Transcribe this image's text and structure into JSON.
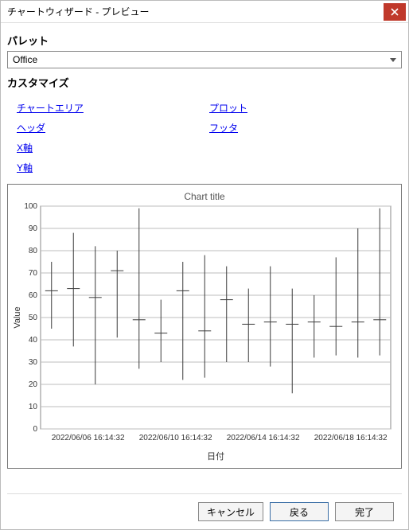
{
  "window": {
    "title": "チャートウィザード - プレビュー"
  },
  "palette": {
    "section_label": "パレット",
    "value": "Office"
  },
  "customize": {
    "section_label": "カスタマイズ",
    "links_left": [
      "チャートエリア",
      "ヘッダ",
      "X軸",
      "Y軸"
    ],
    "links_right": [
      "プロット",
      "フッタ"
    ]
  },
  "buttons": {
    "cancel": "キャンセル",
    "back": "戻る",
    "finish": "完了"
  },
  "chart_data": {
    "type": "bar",
    "title": "Chart title",
    "xlabel": "日付",
    "ylabel": "Value",
    "ylim": [
      0,
      100
    ],
    "yticks": [
      0,
      10,
      20,
      30,
      40,
      50,
      60,
      70,
      80,
      90,
      100
    ],
    "categories": [
      "2022/06/06 16:14:32",
      "",
      "",
      "",
      "2022/06/10 16:14:32",
      "",
      "",
      "",
      "2022/06/14 16:14:32",
      "",
      "",
      "",
      "2022/06/18 16:14:32",
      "",
      "",
      ""
    ],
    "visible_x_labels": [
      "2022/06/06 16:14:32",
      "2022/06/10 16:14:32",
      "2022/06/14 16:14:32",
      "2022/06/18 16:14:32"
    ],
    "series": [
      {
        "high": 75,
        "low": 45,
        "open": 62,
        "close": 62
      },
      {
        "high": 88,
        "low": 37,
        "open": 63,
        "close": 63
      },
      {
        "high": 82,
        "low": 20,
        "open": 59,
        "close": 59
      },
      {
        "high": 80,
        "low": 41,
        "open": 71,
        "close": 71
      },
      {
        "high": 99,
        "low": 27,
        "open": 49,
        "close": 49
      },
      {
        "high": 58,
        "low": 30,
        "open": 43,
        "close": 43
      },
      {
        "high": 75,
        "low": 22,
        "open": 62,
        "close": 62
      },
      {
        "high": 78,
        "low": 23,
        "open": 44,
        "close": 44
      },
      {
        "high": 73,
        "low": 30,
        "open": 58,
        "close": 58
      },
      {
        "high": 63,
        "low": 30,
        "open": 47,
        "close": 47
      },
      {
        "high": 73,
        "low": 28,
        "open": 48,
        "close": 48
      },
      {
        "high": 63,
        "low": 16,
        "open": 47,
        "close": 47
      },
      {
        "high": 60,
        "low": 32,
        "open": 48,
        "close": 48
      },
      {
        "high": 77,
        "low": 33,
        "open": 46,
        "close": 46
      },
      {
        "high": 90,
        "low": 32,
        "open": 48,
        "close": 48
      },
      {
        "high": 99,
        "low": 33,
        "open": 49,
        "close": 49
      }
    ]
  }
}
